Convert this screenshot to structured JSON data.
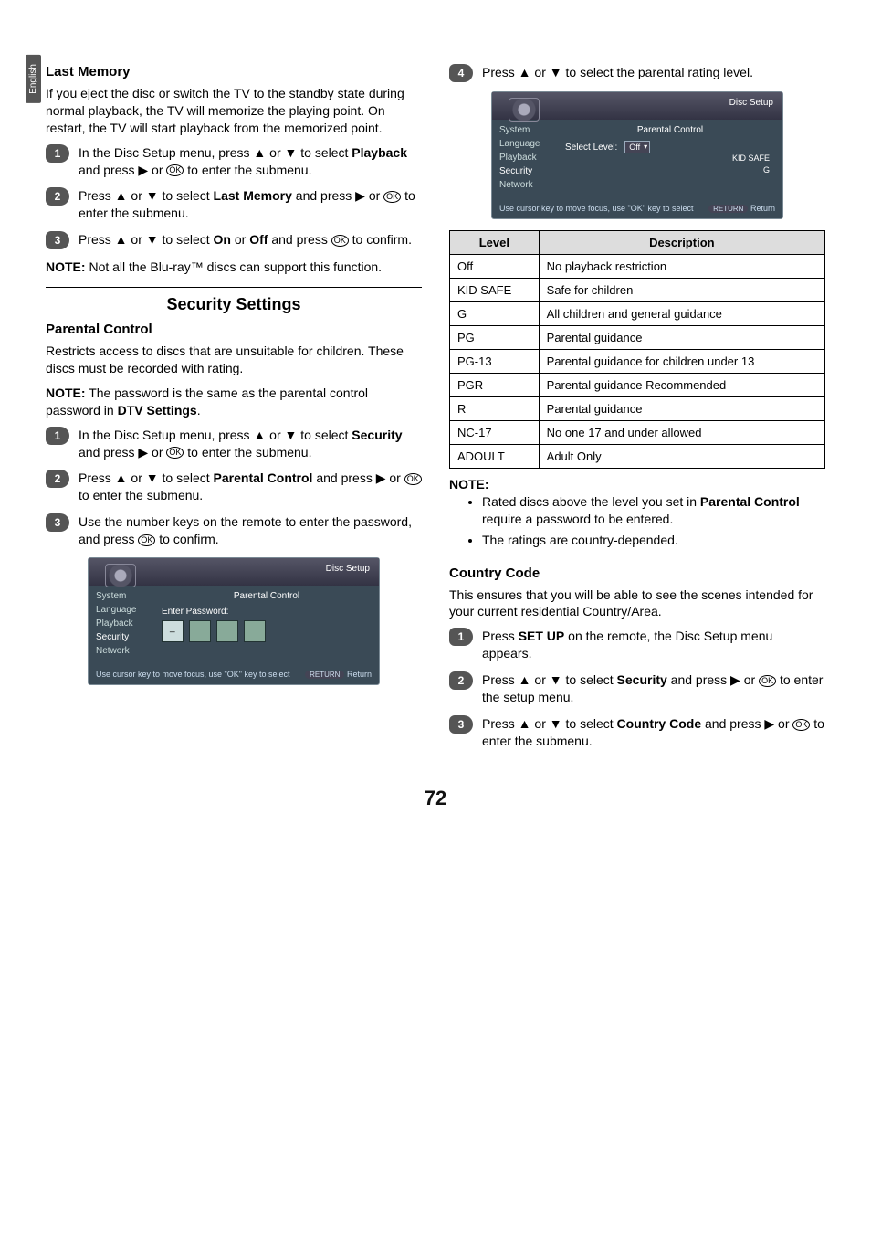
{
  "sideTab": "English",
  "pageNumber": "72",
  "left": {
    "lastMemory": {
      "heading": "Last Memory",
      "intro": "If you eject the disc or switch the TV to the standby state during normal playback, the TV will memorize the playing point. On restart, the TV will start playback from the memorized point.",
      "steps": [
        {
          "num": "1",
          "pre": "In the Disc Setup menu, press ▲ or ▼ to select ",
          "bold": "Playback",
          "post": " and press ▶ or ",
          "ok": "OK",
          "tail": " to enter the submenu."
        },
        {
          "num": "2",
          "pre": "Press ▲ or ▼ to select ",
          "bold": "Last Memory",
          "post": " and press ▶ or ",
          "ok": "OK",
          "tail": " to enter the submenu."
        },
        {
          "num": "3",
          "pre": "Press ▲ or ▼ to select ",
          "bold": "On",
          "mid": " or ",
          "bold2": "Off",
          "post": " and press ",
          "ok": "OK",
          "tail": " to confirm."
        }
      ],
      "noteLabel": "NOTE:",
      "noteBody": " Not all the Blu-ray™ discs can support this function."
    },
    "security": {
      "heading": "Security Settings",
      "sub": "Parental Control",
      "body": "Restricts access to discs that are unsuitable for children. These discs must be recorded with rating.",
      "noteLabel": "NOTE:",
      "notePre": " The password is the same as the parental control password in ",
      "noteBold": "DTV Settings",
      "notePost": ".",
      "steps": [
        {
          "num": "1",
          "pre": "In the Disc Setup menu, press ▲ or ▼ to select ",
          "bold": "Security",
          "post": " and press ▶ or ",
          "ok": "OK",
          "tail": " to enter the submenu."
        },
        {
          "num": "2",
          "pre": "Press ▲ or ▼ to select ",
          "bold": "Parental Control",
          "post": " and press ▶ or ",
          "ok": "OK",
          "tail": " to enter the submenu."
        },
        {
          "num": "3",
          "pre": "Use the number keys on the remote to enter the password, and press ",
          "bold": "",
          "post": "",
          "ok": "OK",
          "tail": " to confirm."
        }
      ]
    },
    "osd1": {
      "title": "Disc Setup",
      "menu": [
        "System",
        "Language",
        "Playback",
        "Security",
        "Network"
      ],
      "contentTitle": "Parental Control",
      "enterPw": "Enter Password:",
      "footerHint": "Use cursor key to move focus, use \"OK\" key to select",
      "return": "Return",
      "returnBtn": "RETURN"
    }
  },
  "right": {
    "topStep": {
      "num": "4",
      "text": "Press ▲ or ▼ to select the parental rating level."
    },
    "osd2": {
      "title": "Disc Setup",
      "menu": [
        "System",
        "Language",
        "Playback",
        "Security",
        "Network"
      ],
      "contentTitle": "Parental Control",
      "selectLabel": "Select Level:",
      "selected": "Off",
      "opts": [
        "KID SAFE",
        "G"
      ],
      "footerHint": "Use cursor key to move focus, use \"OK\" key to select",
      "return": "Return",
      "returnBtn": "RETURN"
    },
    "table": {
      "head": [
        "Level",
        "Description"
      ],
      "rows": [
        [
          "Off",
          "No playback restriction"
        ],
        [
          "KID SAFE",
          "Safe for children"
        ],
        [
          "G",
          "All children and general guidance"
        ],
        [
          "PG",
          "Parental guidance"
        ],
        [
          "PG-13",
          "Parental guidance for children under 13"
        ],
        [
          "PGR",
          "Parental guidance Recommended"
        ],
        [
          "R",
          "Parental guidance"
        ],
        [
          "NC-17",
          "No one 17 and under allowed"
        ],
        [
          "ADOULT",
          "Adult Only"
        ]
      ]
    },
    "noteLabel": "NOTE:",
    "noteItems": [
      {
        "pre": "Rated discs above the level you set in ",
        "bold": "Parental Control",
        "post": " require a password to be entered."
      },
      {
        "pre": "The ratings are country-depended.",
        "bold": "",
        "post": ""
      }
    ],
    "country": {
      "heading": "Country Code",
      "body": "This ensures that you will be able to see the scenes intended for your current residential Country/Area.",
      "steps": [
        {
          "num": "1",
          "pre": "Press ",
          "bold": "SET UP",
          "post": " on the remote, the Disc Setup menu appears.",
          "ok": "",
          "tail": ""
        },
        {
          "num": "2",
          "pre": "Press ▲ or ▼ to select ",
          "bold": "Security",
          "post": " and press ▶ or ",
          "ok": "OK",
          "tail": " to enter the setup menu."
        },
        {
          "num": "3",
          "pre": "Press ▲ or ▼ to select ",
          "bold": "Country Code",
          "post": " and press ▶ or ",
          "ok": "OK",
          "tail": " to enter the submenu."
        }
      ]
    }
  }
}
